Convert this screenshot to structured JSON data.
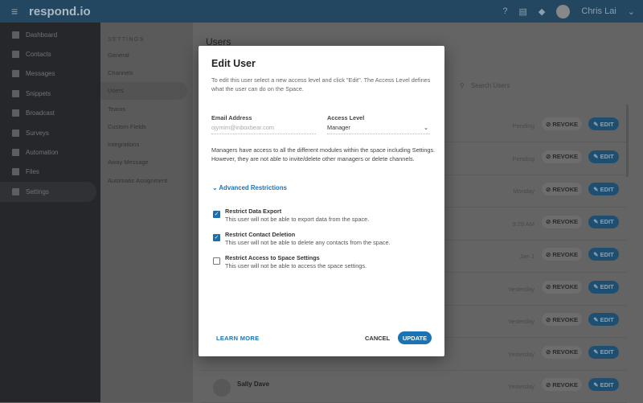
{
  "header": {
    "logo": "respond.io",
    "user": "Chris Lai"
  },
  "sidebar": {
    "items": [
      {
        "label": "Dashboard"
      },
      {
        "label": "Contacts"
      },
      {
        "label": "Messages"
      },
      {
        "label": "Snippets"
      },
      {
        "label": "Broadcast"
      },
      {
        "label": "Surveys"
      },
      {
        "label": "Automation"
      },
      {
        "label": "Files"
      },
      {
        "label": "Settings"
      }
    ]
  },
  "settings": {
    "title": "SETTINGS",
    "items": [
      {
        "label": "General"
      },
      {
        "label": "Channels"
      },
      {
        "label": "Users"
      },
      {
        "label": "Teams"
      },
      {
        "label": "Custom Fields"
      },
      {
        "label": "Integrations"
      },
      {
        "label": "Away Message"
      },
      {
        "label": "Automatic Assignment"
      }
    ]
  },
  "main": {
    "title": "Users",
    "search_placeholder": "Search Users",
    "revoke_label": "REVOKE",
    "edit_label": "EDIT",
    "rows": [
      {
        "time": "Pending"
      },
      {
        "time": "Pending"
      },
      {
        "time": "Monday"
      },
      {
        "time": "9:29 AM"
      },
      {
        "time": "Jan 1"
      },
      {
        "time": "Yesterday"
      },
      {
        "time": "Yesterday"
      },
      {
        "time": "Yesterday"
      },
      {
        "time": "Yesterday",
        "name": "Sally Dave"
      }
    ]
  },
  "modal": {
    "title": "Edit User",
    "description": "To edit this user select a new access level and click \"Edit\". The Access Level defines what the user can do on the Space.",
    "email_label": "Email Address",
    "email_value": "ojymim@inboxbear.com",
    "access_label": "Access Level",
    "access_value": "Manager",
    "note": "Managers have access to all the different modules within the space including Settings. However, they are not able to invite/delete other managers or delete channels.",
    "advanced": "Advanced Restrictions",
    "restrictions": [
      {
        "title": "Restrict Data Export",
        "desc": "This user will not be able to export data from the space.",
        "checked": true
      },
      {
        "title": "Restrict Contact Deletion",
        "desc": "This user will not be able to delete any contacts from the space.",
        "checked": true
      },
      {
        "title": "Restrict Access to Space Settings",
        "desc": "This user will not be able to access the space settings.",
        "checked": false
      }
    ],
    "learn_more": "LEARN MORE",
    "cancel": "CANCEL",
    "update": "UPDATE"
  }
}
